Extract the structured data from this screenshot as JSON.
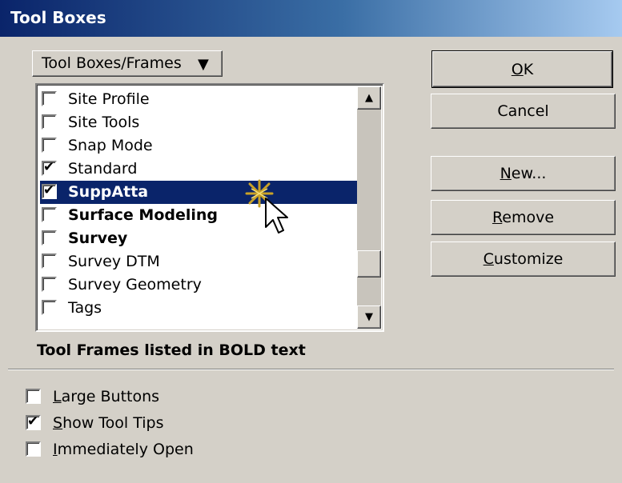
{
  "window": {
    "title": "Tool Boxes"
  },
  "dropdown": {
    "label": "Tool Boxes/Frames",
    "arrow": "▼"
  },
  "list": {
    "items": [
      {
        "label": "Site Profile",
        "checked": false,
        "bold": false,
        "selected": false
      },
      {
        "label": "Site Tools",
        "checked": false,
        "bold": false,
        "selected": false
      },
      {
        "label": "Snap Mode",
        "checked": false,
        "bold": false,
        "selected": false
      },
      {
        "label": "Standard",
        "checked": true,
        "bold": false,
        "selected": false
      },
      {
        "label": "SuppAtta",
        "checked": true,
        "bold": true,
        "selected": true
      },
      {
        "label": "Surface Modeling",
        "checked": false,
        "bold": true,
        "selected": false
      },
      {
        "label": "Survey",
        "checked": false,
        "bold": true,
        "selected": false
      },
      {
        "label": "Survey DTM",
        "checked": false,
        "bold": false,
        "selected": false
      },
      {
        "label": "Survey Geometry",
        "checked": false,
        "bold": false,
        "selected": false
      },
      {
        "label": "Tags",
        "checked": false,
        "bold": false,
        "selected": false
      }
    ],
    "scroll_up": "▲",
    "scroll_down": "▼"
  },
  "note": "Tool Frames listed in BOLD text",
  "buttons": {
    "ok": {
      "mnemonic": "O",
      "rest": "K"
    },
    "cancel": {
      "label": "Cancel"
    },
    "new": {
      "mnemonic": "N",
      "rest": "ew..."
    },
    "remove": {
      "mnemonic": "R",
      "rest": "emove"
    },
    "customize": {
      "mnemonic": "C",
      "rest": "ustomize"
    }
  },
  "options": [
    {
      "mnemonic": "L",
      "rest": "arge Buttons",
      "checked": false
    },
    {
      "mnemonic": "S",
      "rest": "how Tool Tips",
      "checked": true
    },
    {
      "mnemonic": "I",
      "rest": "mmediately Open",
      "checked": false
    }
  ],
  "check_glyph": "✔",
  "colors": {
    "selection": "#0a246a",
    "title_start": "#0a246a",
    "title_end": "#a6caf0",
    "face": "#d4d0c8"
  }
}
